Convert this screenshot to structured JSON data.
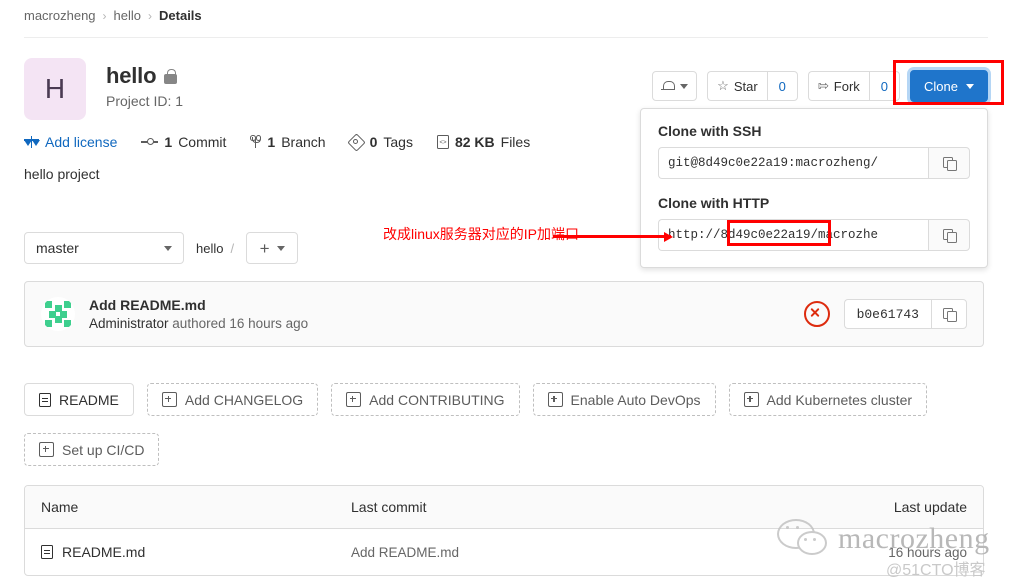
{
  "breadcrumb": {
    "owner": "macrozheng",
    "project": "hello",
    "current": "Details",
    "separator": "›"
  },
  "project": {
    "avatar_letter": "H",
    "name": "hello",
    "visibility_icon": "lock-icon",
    "project_id_label": "Project ID: 1",
    "description": "hello project"
  },
  "header_actions": {
    "notification_icon": "bell-icon",
    "star_icon": "star-icon",
    "star_label": "Star",
    "star_count": "0",
    "fork_icon": "fork-icon",
    "fork_label": "Fork",
    "fork_count": "0",
    "clone_label": "Clone",
    "clone_button_color": "#1f75cb"
  },
  "clone_dropdown": {
    "ssh_label": "Clone with SSH",
    "ssh_url": "git@8d49c0e22a19:macrozheng/",
    "http_label": "Clone with HTTP",
    "http_url_prefix": "http://",
    "http_url_host": "8d49c0e22a19",
    "http_url_suffix": "/macrozhe",
    "copy_icon": "copy-icon"
  },
  "annotation": {
    "text": "改成linux服务器对应的IP加端口",
    "color": "#ff0000",
    "arrow_icon": "arrow-right-icon"
  },
  "stats": [
    {
      "icon": "scale-icon",
      "num": "",
      "label": "Add license",
      "link": true
    },
    {
      "icon": "commit-icon",
      "num": "1",
      "label": "Commit",
      "link": false
    },
    {
      "icon": "branch-icon",
      "num": "1",
      "label": "Branch",
      "link": false
    },
    {
      "icon": "tag-icon",
      "num": "0",
      "label": "Tags",
      "link": false
    },
    {
      "icon": "file-icon",
      "num": "82 KB",
      "label": "Files",
      "link": false
    }
  ],
  "branch_bar": {
    "selected_branch": "master",
    "path_root": "hello",
    "path_separator": "/",
    "add_icon": "plus-icon",
    "dropdown_icon": "chevron-down-icon"
  },
  "last_commit": {
    "avatar_icon": "identicon-avatar",
    "title": "Add README.md",
    "author": "Administrator",
    "meta": "authored 16 hours ago",
    "pipeline_status_icon": "pipeline-failed-icon",
    "sha": "b0e61743",
    "copy_icon": "copy-icon"
  },
  "quick_actions": {
    "row1": [
      {
        "label": "README",
        "icon": "document-icon",
        "style": "solid"
      },
      {
        "label": "Add CHANGELOG",
        "icon": "plus-square-icon",
        "style": "dashed"
      },
      {
        "label": "Add CONTRIBUTING",
        "icon": "plus-square-icon",
        "style": "dashed"
      },
      {
        "label": "Enable Auto DevOps",
        "icon": "plus-square-icon",
        "style": "dashed"
      },
      {
        "label": "Add Kubernetes cluster",
        "icon": "plus-square-icon",
        "style": "dashed"
      }
    ],
    "row2": [
      {
        "label": "Set up CI/CD",
        "icon": "plus-square-icon",
        "style": "dashed"
      }
    ]
  },
  "files_table": {
    "columns": [
      "Name",
      "Last commit",
      "Last update"
    ],
    "rows": [
      {
        "name": "README.md",
        "icon": "file-text-icon",
        "last_commit": "Add README.md",
        "last_update": "16 hours ago"
      }
    ]
  },
  "watermarks": {
    "wechat_name": "macrozheng",
    "site": "@51CTO博客"
  }
}
